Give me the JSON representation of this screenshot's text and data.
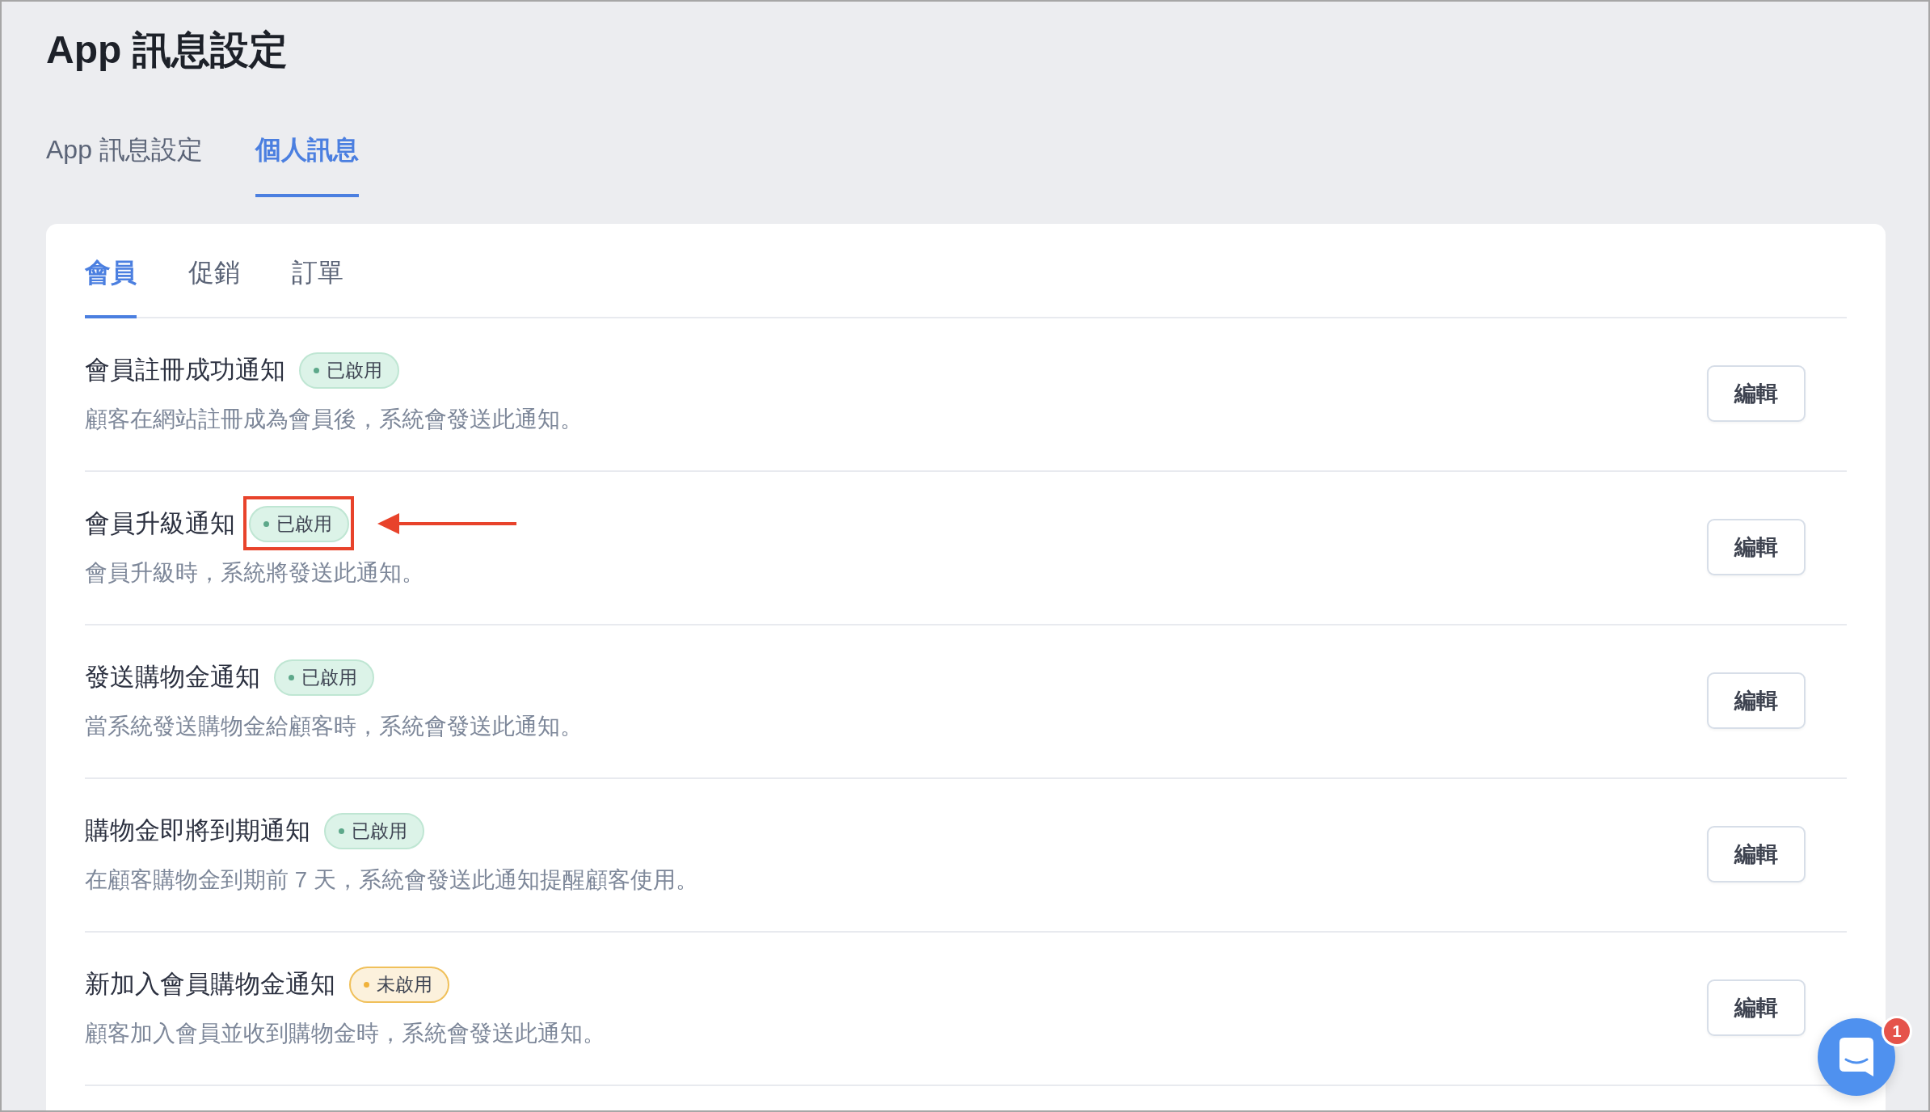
{
  "page": {
    "title": "App 訊息設定"
  },
  "tabs": [
    {
      "label": "App 訊息設定",
      "selected": false
    },
    {
      "label": "個人訊息",
      "selected": true
    }
  ],
  "card": {
    "tabs": [
      {
        "label": "會員",
        "selected": true
      },
      {
        "label": "促銷",
        "selected": false
      },
      {
        "label": "訂單",
        "selected": false
      }
    ],
    "notifications": [
      {
        "title": "會員註冊成功通知",
        "status": "已啟用",
        "enabled": true,
        "highlighted": false,
        "description": "顧客在網站註冊成為會員後，系統會發送此通知。",
        "button": "編輯"
      },
      {
        "title": "會員升級通知",
        "status": "已啟用",
        "enabled": true,
        "highlighted": true,
        "description": "會員升級時，系統將發送此通知。",
        "button": "編輯"
      },
      {
        "title": "發送購物金通知",
        "status": "已啟用",
        "enabled": true,
        "highlighted": false,
        "description": "當系統發送購物金給顧客時，系統會發送此通知。",
        "button": "編輯"
      },
      {
        "title": "購物金即將到期通知",
        "status": "已啟用",
        "enabled": true,
        "highlighted": false,
        "description": "在顧客購物金到期前 7 天，系統會發送此通知提醒顧客使用。",
        "button": "編輯"
      },
      {
        "title": "新加入會員購物金通知",
        "status": "未啟用",
        "enabled": false,
        "highlighted": false,
        "description": "顧客加入會員並收到購物金時，系統會發送此通知。",
        "button": "編輯"
      }
    ]
  },
  "chat": {
    "unread": "1"
  }
}
